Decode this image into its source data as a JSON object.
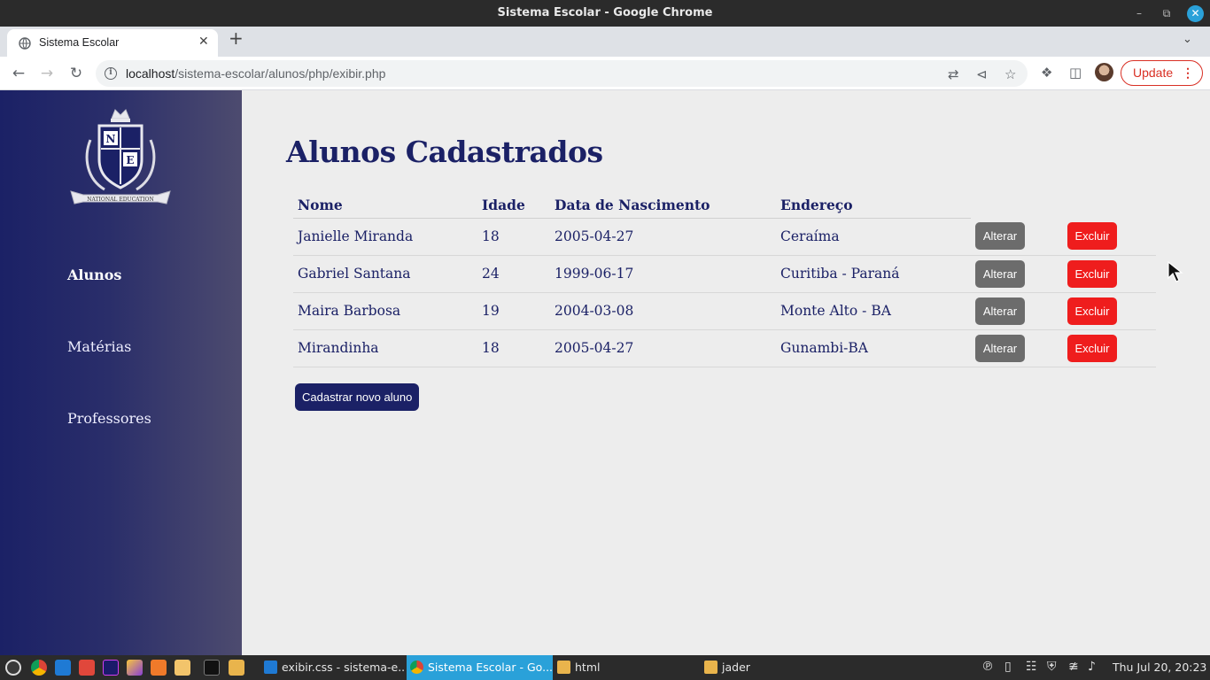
{
  "window": {
    "title": "Sistema Escolar - Google Chrome"
  },
  "browser": {
    "tab_title": "Sistema Escolar",
    "url_host": "localhost",
    "url_path": "/sistema-escolar/alunos/php/exibir.php",
    "update_label": "Update"
  },
  "sidebar": {
    "logo_text": {
      "top_left": "N",
      "bottom_right": "E",
      "ribbon": "NATIONAL EDUCATION"
    },
    "items": [
      {
        "label": "Alunos",
        "active": true
      },
      {
        "label": "Matérias",
        "active": false
      },
      {
        "label": "Professores",
        "active": false
      }
    ]
  },
  "main": {
    "title": "Alunos Cadastrados",
    "table": {
      "headers": [
        "Nome",
        "Idade",
        "Data de Nascimento",
        "Endereço"
      ],
      "rows": [
        {
          "nome": "Janielle Miranda",
          "idade": "18",
          "nascimento": "2005-04-27",
          "endereco": "Ceraíma"
        },
        {
          "nome": "Gabriel Santana",
          "idade": "24",
          "nascimento": "1999-06-17",
          "endereco": "Curitiba - Paraná"
        },
        {
          "nome": "Maira Barbosa",
          "idade": "19",
          "nascimento": "2004-03-08",
          "endereco": "Monte Alto - BA"
        },
        {
          "nome": "Mirandinha",
          "idade": "18",
          "nascimento": "2005-04-27",
          "endereco": "Gunambi-BA"
        }
      ],
      "edit_label": "Alterar",
      "delete_label": "Excluir"
    },
    "new_button_label": "Cadastrar novo aluno"
  },
  "taskbar": {
    "tasks": [
      {
        "label": "exibir.css - sistema-e...",
        "icon": "vscode-icon"
      },
      {
        "label": "Sistema Escolar - Go...",
        "icon": "chrome-icon",
        "active": true
      },
      {
        "label": "html",
        "icon": "folder-icon"
      },
      {
        "label": "jader",
        "icon": "home-folder-icon"
      }
    ],
    "clock": "Thu Jul 20, 20:23"
  },
  "colors": {
    "primary": "#1b2166",
    "delete": "#ef1d1d",
    "edit": "#6c6c6c",
    "page_bg": "#ededed"
  }
}
